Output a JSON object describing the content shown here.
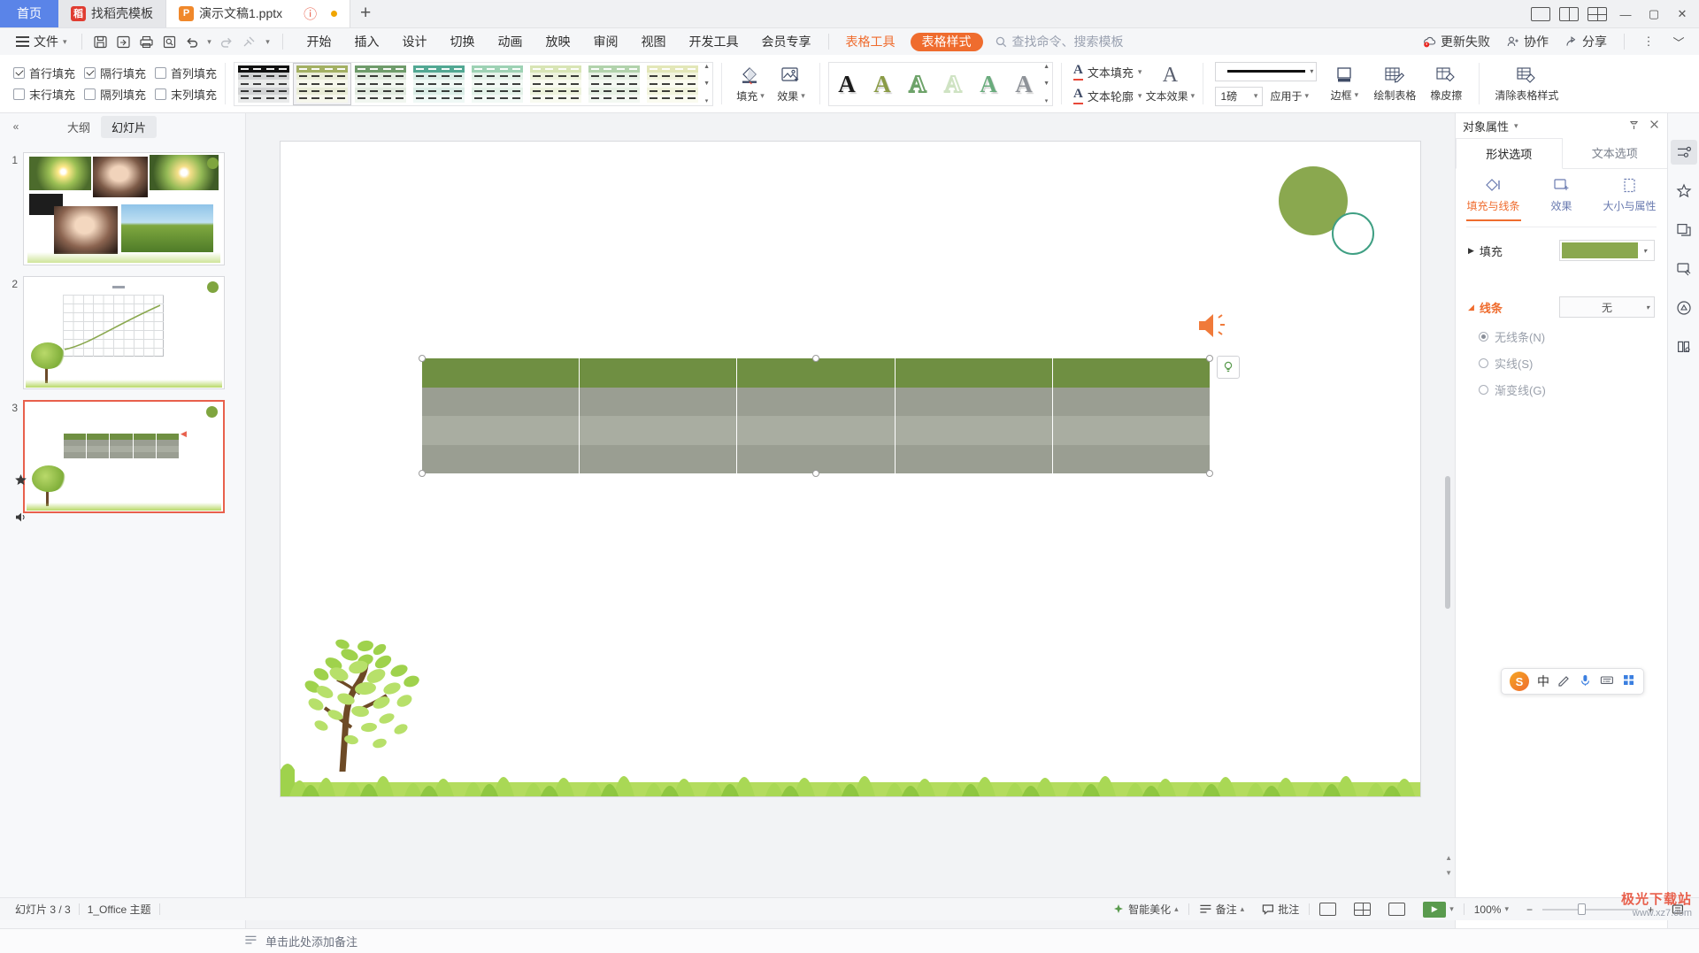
{
  "window": {
    "tabs": [
      {
        "label": "首页",
        "type": "home"
      },
      {
        "label": "找稻壳模板",
        "type": "normal",
        "favicon": "docer-icon"
      },
      {
        "label": "演示文稿1.pptx",
        "type": "active",
        "favicon": "wpp-icon"
      }
    ],
    "new_tab_label": "+",
    "controls": {
      "minimize": "—",
      "maximize": "▢",
      "close": "✕"
    },
    "layout_icons": [
      "layout-single-icon",
      "layout-split-icon",
      "layout-grid-icon"
    ]
  },
  "menubar": {
    "file_label": "文件",
    "quick_icons": [
      "save-icon",
      "save-as-icon",
      "print-icon",
      "print-preview-icon",
      "undo-icon",
      "redo-icon",
      "format-brush-icon",
      "customize-icon"
    ],
    "tabs": [
      {
        "label": "开始",
        "style": "normal"
      },
      {
        "label": "插入",
        "style": "normal"
      },
      {
        "label": "设计",
        "style": "normal"
      },
      {
        "label": "切换",
        "style": "normal"
      },
      {
        "label": "动画",
        "style": "normal"
      },
      {
        "label": "放映",
        "style": "normal"
      },
      {
        "label": "审阅",
        "style": "normal"
      },
      {
        "label": "视图",
        "style": "normal"
      },
      {
        "label": "开发工具",
        "style": "normal"
      },
      {
        "label": "会员专享",
        "style": "normal"
      },
      {
        "label": "表格工具",
        "style": "orange"
      },
      {
        "label": "表格样式",
        "style": "pill"
      }
    ],
    "search_placeholder": "查找命令、搜索模板",
    "right_items": [
      {
        "label": "更新失败",
        "icon": "cloud-error-icon"
      },
      {
        "label": "协作",
        "icon": "collaborate-icon"
      },
      {
        "label": "分享",
        "icon": "share-icon"
      }
    ],
    "more_icon": "more-vertical-icon",
    "collapse_ribbon_icon": "chevron-up-icon"
  },
  "ribbon": {
    "checkboxes": [
      {
        "label": "首行填充",
        "checked": true
      },
      {
        "label": "隔行填充",
        "checked": true
      },
      {
        "label": "首列填充",
        "checked": false
      },
      {
        "label": "末行填充",
        "checked": false
      },
      {
        "label": "隔列填充",
        "checked": false
      },
      {
        "label": "末列填充",
        "checked": false
      }
    ],
    "table_styles": [
      {
        "name": "style-black",
        "header": "#111111",
        "odd": "#d2d3d4",
        "even": "#e9eaea",
        "selected": false
      },
      {
        "name": "style-olive",
        "header": "#a3b063",
        "odd": "#eaedd8",
        "even": "#f6f7ec",
        "selected": true
      },
      {
        "name": "style-green",
        "header": "#6f9c6b",
        "odd": "#e2ebe0",
        "even": "#f1f6f0",
        "selected": false
      },
      {
        "name": "style-teal",
        "header": "#52a893",
        "odd": "#dceee8",
        "even": "#eff8f5",
        "selected": false
      },
      {
        "name": "style-lightgreen",
        "header": "#9ed2b4",
        "odd": "#e4f2e9",
        "even": "#f2f9f5",
        "selected": false
      },
      {
        "name": "style-palegreen",
        "header": "#d8e5b5",
        "odd": "#eef3dd",
        "even": "#f8faf0",
        "selected": false
      },
      {
        "name": "style-green2",
        "header": "#b2d3ac",
        "odd": "#e7f1e5",
        "even": "#f3f8f2",
        "selected": false
      },
      {
        "name": "style-palelime",
        "header": "#e3e7b8",
        "odd": "#f2f4de",
        "even": "#fafbf0",
        "selected": false
      }
    ],
    "gallery_scroll_up": "▲",
    "gallery_scroll_down": "▼",
    "gallery_more": "▾",
    "fill_button": {
      "label": "填充",
      "icon": "fill-bucket-icon"
    },
    "effects_button": {
      "label": "效果",
      "icon": "picture-effects-icon"
    },
    "wordart_styles": [
      {
        "name": "wordart-black",
        "color": "#1a1a1a",
        "mode": "fill"
      },
      {
        "name": "wordart-olive",
        "color": "#8a9b46",
        "mode": "fill"
      },
      {
        "name": "wordart-green-outline",
        "color": "#6ea36a",
        "mode": "outline"
      },
      {
        "name": "wordart-pale-outline",
        "color": "#cfe3c3",
        "mode": "outline"
      },
      {
        "name": "wordart-green",
        "color": "#69ab7c",
        "mode": "fill"
      },
      {
        "name": "wordart-gray",
        "color": "#8e9298",
        "mode": "fill"
      }
    ],
    "wordart_glyph": "A",
    "text_fill": {
      "label": "文本填充",
      "icon": "text-fill-icon"
    },
    "text_outline": {
      "label": "文本轮廓",
      "icon": "text-outline-icon"
    },
    "text_effects": {
      "label": "文本效果",
      "icon": "text-effects-icon"
    },
    "line_weight_value": "1磅",
    "apply_to_label": "应用于",
    "border_button": {
      "label": "边框",
      "icon": "border-icon"
    },
    "draw_table": {
      "label": "绘制表格",
      "icon": "draw-table-icon"
    },
    "eraser": {
      "label": "橡皮擦",
      "icon": "eraser-icon"
    },
    "clear_style": {
      "label": "清除表格样式",
      "icon": "clear-table-style-icon"
    }
  },
  "left_panel": {
    "collapse_icon": "collapse-left-icon",
    "tabs": [
      {
        "label": "大纲",
        "active": false
      },
      {
        "label": "幻灯片",
        "active": true
      }
    ],
    "slides": [
      {
        "number": "1",
        "selected": false,
        "kind": "photos"
      },
      {
        "number": "2",
        "selected": false,
        "kind": "chart"
      },
      {
        "number": "3",
        "selected": true,
        "kind": "table"
      }
    ],
    "add_slide_label": "+",
    "rail_icons": [
      "star-icon",
      "audio-icon"
    ]
  },
  "canvas": {
    "notes_placeholder": "单击此处添加备注",
    "notes_icon": "notes-icon",
    "table": {
      "rows": 4,
      "cols": 5,
      "header_color": "#6f8f42",
      "band_a": "#9a9e92",
      "band_b": "#a9ada1"
    },
    "float_button_icon": "table-layout-icon",
    "audio_icon": "speaker-icon"
  },
  "right_panel": {
    "title": "对象属性",
    "title_caret": "▾",
    "pin_icon": "pin-icon",
    "close_icon": "close-icon",
    "tabs": [
      {
        "label": "形状选项",
        "active": true
      },
      {
        "label": "文本选项",
        "active": false
      }
    ],
    "subtabs": [
      {
        "label": "填充与线条",
        "icon": "fill-line-icon",
        "active": true
      },
      {
        "label": "效果",
        "icon": "effects-icon",
        "active": false
      },
      {
        "label": "大小与属性",
        "icon": "size-properties-icon",
        "active": false
      }
    ],
    "fill_section": {
      "label": "填充",
      "expanded": false,
      "swatch_color": "#8aa84f"
    },
    "line_section": {
      "label": "线条",
      "expanded": true,
      "dropdown_value": "无",
      "radios": [
        {
          "label": "无线条(N)",
          "selected": true
        },
        {
          "label": "实线(S)",
          "selected": false
        },
        {
          "label": "渐变线(G)",
          "selected": false
        }
      ]
    },
    "rail_icons": [
      {
        "name": "properties-icon",
        "active": true
      },
      {
        "name": "effects-star-icon",
        "active": false
      },
      {
        "name": "selection-pane-icon",
        "active": false
      },
      {
        "name": "design-ideas-icon",
        "active": false
      },
      {
        "name": "smart-icon",
        "active": false
      },
      {
        "name": "reading-icon",
        "active": false
      }
    ]
  },
  "status_bar": {
    "slide_counter": "幻灯片 3 / 3",
    "theme_name": "1_Office 主题",
    "beautify_label": "智能美化",
    "notes_label": "备注",
    "comments_label": "批注",
    "zoom_value": "100%",
    "view_icons": [
      "normal-view-icon",
      "slide-sorter-icon",
      "reading-view-icon"
    ],
    "play_icon": "play-icon",
    "zoom_out": "−",
    "zoom_in": "+",
    "fit_icon": "fit-screen-icon"
  },
  "ime": {
    "logo": "S",
    "mode_label": "中",
    "icons": [
      "pen-icon",
      "mic-icon",
      "keyboard-icon",
      "apps-icon"
    ]
  },
  "watermark": {
    "line1": "极光下载站",
    "line2": "www.xz7.com"
  }
}
